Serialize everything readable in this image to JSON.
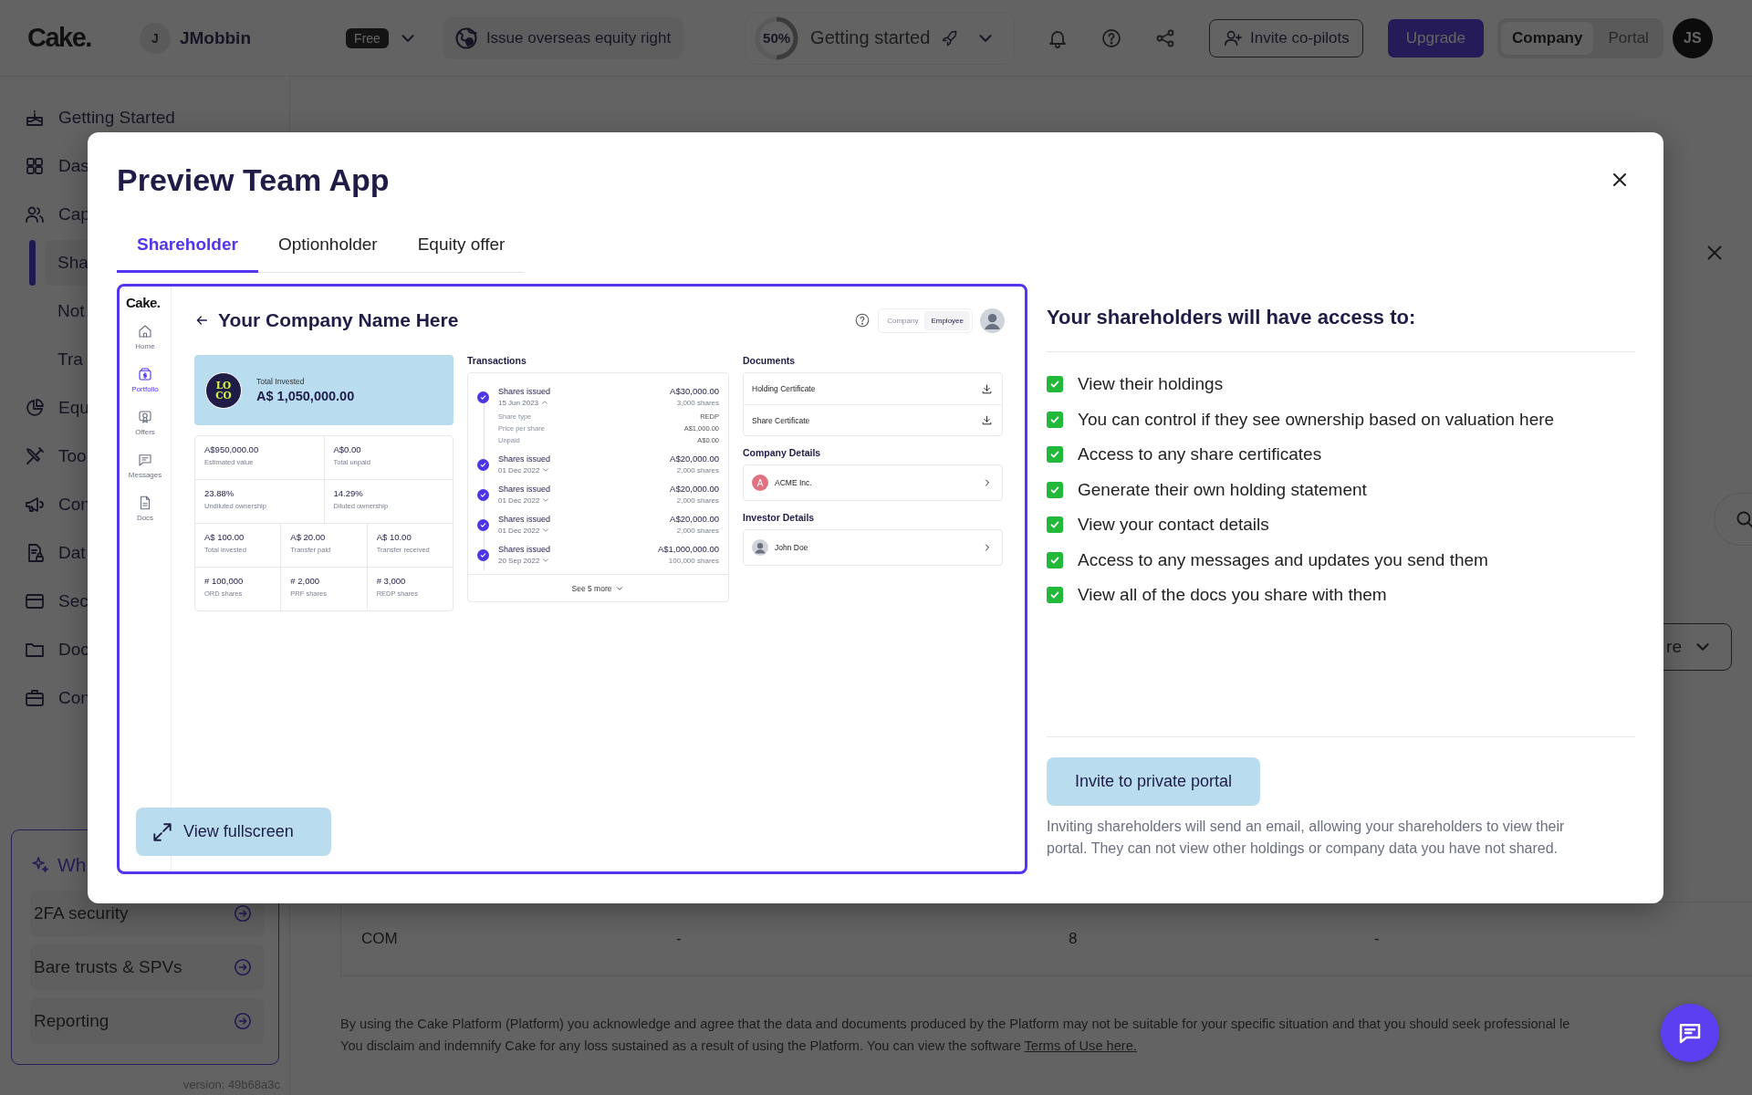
{
  "topbar": {
    "logo": "Cake.",
    "account": {
      "initial": "J",
      "name": "JMobbin",
      "plan": "Free"
    },
    "action": "Issue overseas equity right",
    "progress": {
      "level": 0.5,
      "reading": "50%",
      "label": "Getting started"
    },
    "invite": "Invite co-pilots",
    "upgrade": "Upgrade",
    "mode_toggle": [
      {
        "label": "Company",
        "selected": true
      },
      {
        "label": "Portal",
        "selected": false
      }
    ],
    "user_initials": "JS"
  },
  "sidebar": {
    "items": [
      {
        "label": "Getting Started",
        "kind": "main",
        "selected": false
      },
      {
        "label": "Das",
        "kind": "main",
        "selected": false
      },
      {
        "label": "Cap",
        "kind": "main",
        "selected": false
      },
      {
        "label": "Sha",
        "kind": "sub",
        "selected": true
      },
      {
        "label": "Not",
        "kind": "sub",
        "selected": false
      },
      {
        "label": "Tra",
        "kind": "sub",
        "selected": false
      },
      {
        "label": "Equ",
        "kind": "main",
        "selected": false
      },
      {
        "label": "Too",
        "kind": "main",
        "selected": false
      },
      {
        "label": "Con",
        "kind": "main",
        "selected": false
      },
      {
        "label": "Dat",
        "kind": "main",
        "selected": false
      },
      {
        "label": "Sec",
        "kind": "main",
        "selected": false
      },
      {
        "label": "Doc",
        "kind": "main",
        "selected": false
      },
      {
        "label": "Con",
        "kind": "main",
        "selected": false
      }
    ],
    "whats_new": {
      "title": "Wh",
      "items": [
        "2FA security",
        "Bare trusts & SPVs",
        "Reporting"
      ]
    },
    "version": "version: 49b68a3c"
  },
  "backdrop": {
    "dropdown_fragment": "re",
    "table_row": [
      "COM",
      "-",
      "8",
      "-"
    ],
    "disclaimer": {
      "line_1": "By using the Cake Platform (Platform) you acknowledge and agree that the data and documents produced by the Platform may not be suitable for your specific situation and that you should seek professional le",
      "line_2": "You disclaim and indemnify Cake for any loss sustained as a result of using the Platform. You can view the software",
      "link": "Terms of Use here."
    }
  },
  "modal": {
    "title": "Preview Team App",
    "tabs": [
      {
        "label": "Shareholder",
        "selected": true
      },
      {
        "label": "Optionholder",
        "selected": false
      },
      {
        "label": "Equity offer",
        "selected": false
      }
    ],
    "preview": {
      "logo": "Cake.",
      "nav": [
        {
          "label": "Home",
          "selected": false
        },
        {
          "label": "Portfolio",
          "selected": true
        },
        {
          "label": "Offers",
          "selected": false
        },
        {
          "label": "Messages",
          "selected": false
        },
        {
          "label": "Docs",
          "selected": false
        }
      ],
      "company": "Your Company Name Here",
      "view_toggle": [
        {
          "label": "Company",
          "selected": false
        },
        {
          "label": "Employee",
          "selected": true
        }
      ],
      "total": {
        "logo_text": [
          "LO",
          "CO"
        ],
        "label": "Total Invested",
        "value": "A$ 1,050,000.00"
      },
      "stats": [
        [
          {
            "value": "A$950,000.00",
            "label": "Estimated value"
          },
          {
            "value": "A$0.00",
            "label": "Total unpaid"
          }
        ],
        [
          {
            "value": "23.88%",
            "label": "Undiluted ownership"
          },
          {
            "value": "14.29%",
            "label": "Diluted ownership"
          }
        ],
        [
          {
            "value": "A$ 100.00",
            "label": "Total invested"
          },
          {
            "value": "A$ 20.00",
            "label": "Transfer paid"
          },
          {
            "value": "A$ 10.00",
            "label": "Transfer received"
          }
        ],
        [
          {
            "value": "# 100,000",
            "label": "ORD shares"
          },
          {
            "value": "# 2,000",
            "label": "PRF shares"
          },
          {
            "value": "# 3,000",
            "label": "REDP shares"
          }
        ]
      ],
      "transactions": {
        "title": "Transactions",
        "items": [
          {
            "title": "Shares issued",
            "date": "15 Jun 2023",
            "expanded": true,
            "amount": "A$30,000.00",
            "shares": "3,000 shares",
            "details": [
              {
                "label": "Share type",
                "value": "REDP"
              },
              {
                "label": "Price per share",
                "value": "A$1,000.00"
              },
              {
                "label": "Unpaid",
                "value": "A$0.00"
              }
            ]
          },
          {
            "title": "Shares issued",
            "date": "01 Dec 2022",
            "expanded": false,
            "amount": "A$20,000.00",
            "shares": "2,000 shares"
          },
          {
            "title": "Shares issued",
            "date": "01 Dec 2022",
            "expanded": false,
            "amount": "A$20,000.00",
            "shares": "2,000 shares"
          },
          {
            "title": "Shares issued",
            "date": "01 Dec 2022",
            "expanded": false,
            "amount": "A$20,000.00",
            "shares": "2,000 shares"
          },
          {
            "title": "Shares issued",
            "date": "20 Sep 2022",
            "expanded": false,
            "amount": "A$1,000,000.00",
            "shares": "100,000 shares"
          }
        ],
        "more": "See 5 more"
      },
      "documents": {
        "title": "Documents",
        "items": [
          "Holding Certificate",
          "Share Certificate"
        ]
      },
      "company_details": {
        "title": "Company Details",
        "initial": "A",
        "name": "ACME Inc."
      },
      "investor_details": {
        "title": "Investor Details",
        "name": "John Doe"
      }
    },
    "fullscreen_button": "View fullscreen",
    "access": {
      "title": "Your shareholders will have access to:",
      "items": [
        {
          "label": "View their holdings",
          "checked": true
        },
        {
          "label": "You can control if they see ownership based on valuation here",
          "checked": true
        },
        {
          "label": "Access to any share certificates",
          "checked": true
        },
        {
          "label": "Generate their own holding statement",
          "checked": true
        },
        {
          "label": "View your contact details",
          "checked": true
        },
        {
          "label": "Access to any messages and updates you send them",
          "checked": true
        },
        {
          "label": "View all of the docs you share with them",
          "checked": true
        }
      ],
      "invite_button": "Invite to private portal",
      "note": "Inviting shareholders will send an email, allowing your shareholders to view their portal. They can not view other holdings or company data you have not shared."
    }
  }
}
